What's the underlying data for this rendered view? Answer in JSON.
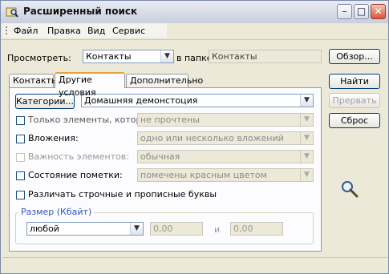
{
  "window": {
    "title": "Расширенный поиск",
    "minimize": "–",
    "maximize": "□",
    "close": "✕"
  },
  "menu": [
    "Файл",
    "Правка",
    "Вид",
    "Сервис"
  ],
  "search_in": {
    "label": "Просмотреть:",
    "value": "Контакты",
    "folder_label": "в папке:",
    "folder_value": "Контакты",
    "browse": "Обзор..."
  },
  "tabs": [
    "Контакты",
    "Другие условия",
    "Дополнительно"
  ],
  "buttons": {
    "find": "Найти",
    "stop": "Прервать",
    "new": "Сброс"
  },
  "category": {
    "button": "Категории...",
    "value": "Домашняя демонстоция"
  },
  "rows": [
    {
      "label": "Только элементы, которые:",
      "value": "не прочтены"
    },
    {
      "label": "Вложения:",
      "value": "одно или несколько вложений"
    },
    {
      "label": "Важность элементов:",
      "value": "обычная"
    },
    {
      "label": "Состояние пометки:",
      "value": "помечены красным цветом"
    }
  ],
  "match_case": "Различать строчные и прописные буквы",
  "size": {
    "title": "Размер (Кбайт)",
    "condition": "любой",
    "from": "0,00",
    "and": "и",
    "to": "0,00"
  }
}
